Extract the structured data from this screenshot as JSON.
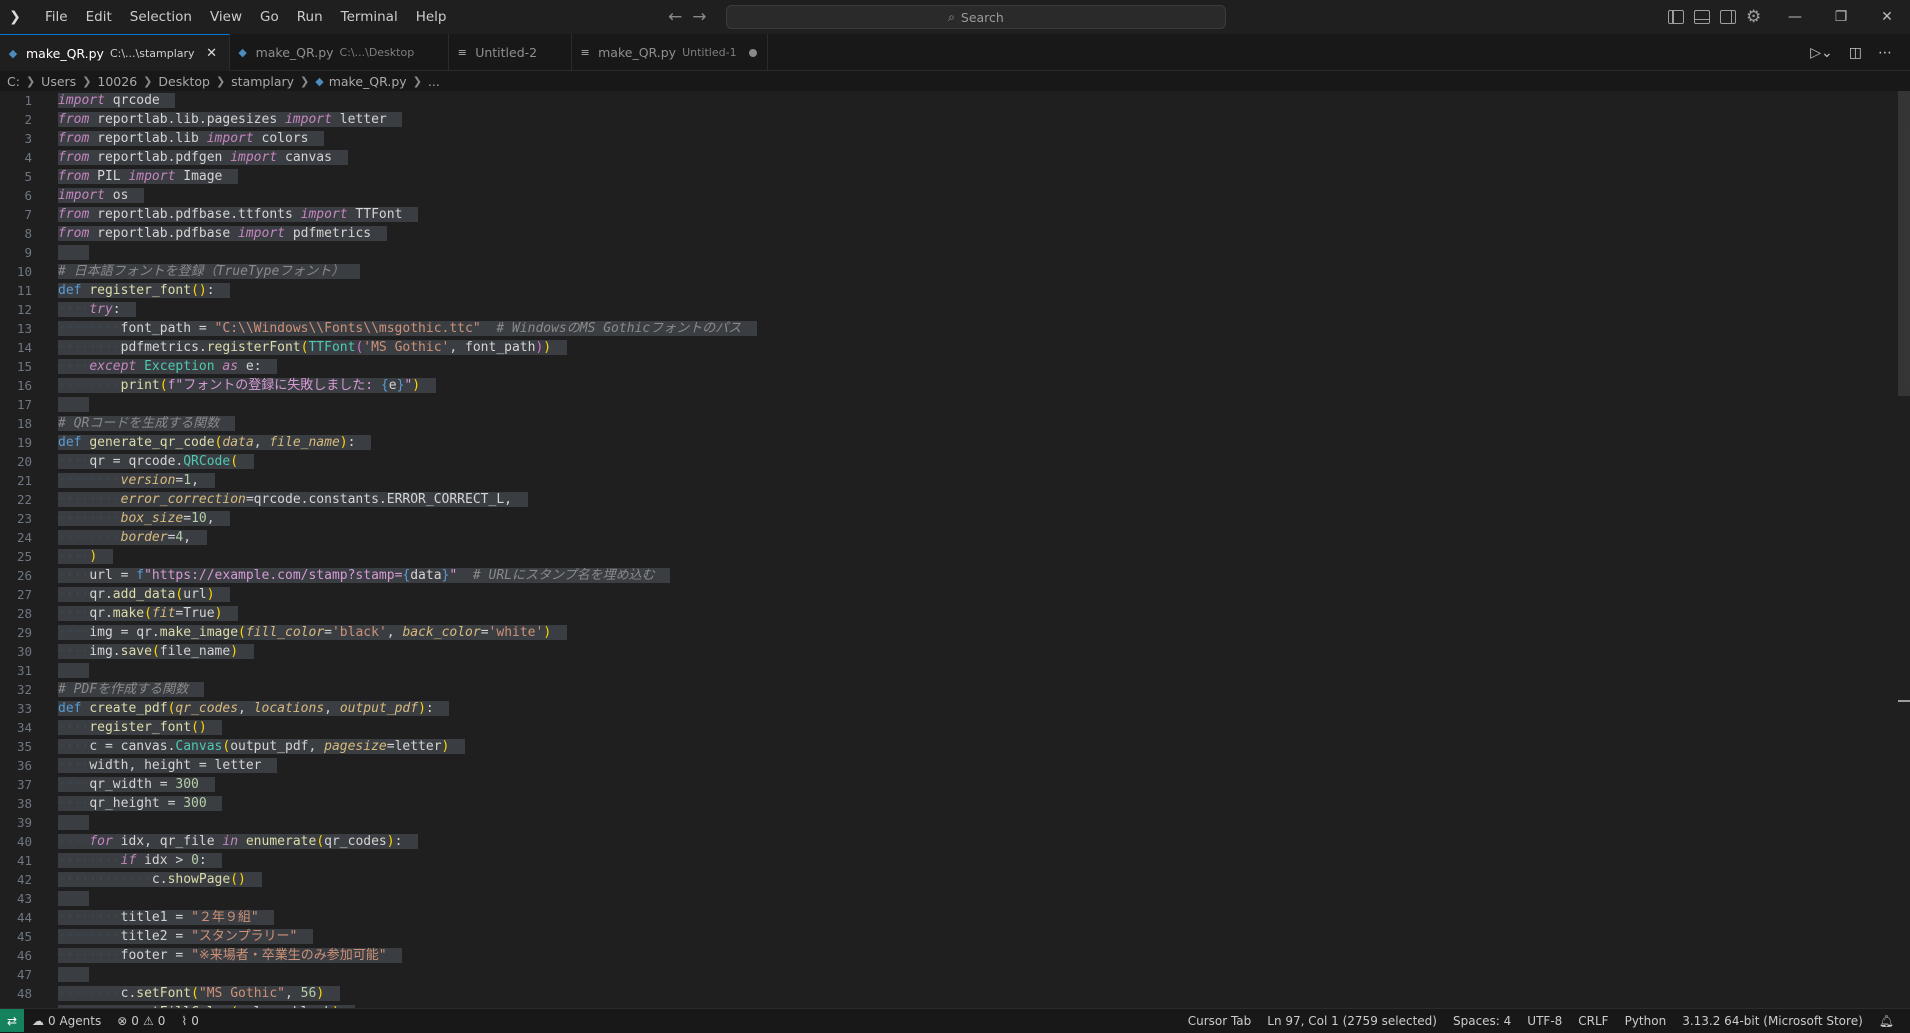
{
  "menu": [
    "File",
    "Edit",
    "Selection",
    "View",
    "Go",
    "Run",
    "Terminal",
    "Help"
  ],
  "search": {
    "label": "Search"
  },
  "tabs": [
    {
      "name": "make_QR.py",
      "desc": "C:\\...\\stamplary",
      "active": true,
      "icon": "python-icon",
      "close": "×"
    },
    {
      "name": "make_QR.py",
      "desc": "C:\\...\\Desktop",
      "active": false,
      "icon": "python-icon"
    },
    {
      "name": "Untitled-2",
      "desc": "",
      "active": false,
      "icon": "file-icon"
    },
    {
      "name": "make_QR.py",
      "desc": "Untitled-1",
      "active": false,
      "icon": "file-icon",
      "dirty": true
    }
  ],
  "breadcrumb": [
    "C:",
    "Users",
    "10026",
    "Desktop",
    "stamplary",
    "make_QR.py",
    "..."
  ],
  "status": {
    "agents": "0 Agents",
    "errors": "0",
    "warnings": "0",
    "ports": "0",
    "cursor_tab": "Cursor Tab",
    "position": "Ln 97, Col 1 (2759 selected)",
    "spaces": "Spaces: 4",
    "encoding": "UTF-8",
    "eol": "CRLF",
    "language": "Python",
    "interpreter": "3.13.2 64-bit (Microsoft Store)"
  },
  "code_lines": [
    [
      [
        "kw",
        "import"
      ],
      [
        "var",
        " qrcode"
      ]
    ],
    [
      [
        "kw",
        "from"
      ],
      [
        "var",
        " reportlab.lib.pagesizes "
      ],
      [
        "kw",
        "import"
      ],
      [
        "var",
        " letter"
      ]
    ],
    [
      [
        "kw",
        "from"
      ],
      [
        "var",
        " reportlab.lib "
      ],
      [
        "kw",
        "import"
      ],
      [
        "var",
        " colors"
      ]
    ],
    [
      [
        "kw",
        "from"
      ],
      [
        "var",
        " reportlab.pdfgen "
      ],
      [
        "kw",
        "import"
      ],
      [
        "var",
        " canvas"
      ]
    ],
    [
      [
        "kw",
        "from"
      ],
      [
        "var",
        " PIL "
      ],
      [
        "kw",
        "import"
      ],
      [
        "var",
        " Image"
      ]
    ],
    [
      [
        "kw",
        "import"
      ],
      [
        "var",
        " os"
      ]
    ],
    [
      [
        "kw",
        "from"
      ],
      [
        "var",
        " reportlab.pdfbase.ttfonts "
      ],
      [
        "kw",
        "import"
      ],
      [
        "var",
        " TTFont"
      ]
    ],
    [
      [
        "kw",
        "from"
      ],
      [
        "var",
        " reportlab.pdfbase "
      ],
      [
        "kw",
        "import"
      ],
      [
        "var",
        " pdfmetrics"
      ]
    ],
    [],
    [
      [
        "cm",
        "# 日本語フォントを登録（TrueTypeフォント）"
      ]
    ],
    [
      [
        "kw2",
        "def"
      ],
      [
        "var",
        " "
      ],
      [
        "fn",
        "register_font"
      ],
      [
        "br",
        "()"
      ],
      [
        "var",
        ":"
      ]
    ],
    [
      [
        "ws",
        "····"
      ],
      [
        "kw",
        "try"
      ],
      [
        "var",
        ":"
      ]
    ],
    [
      [
        "ws",
        "········"
      ],
      [
        "var",
        "font_path = "
      ],
      [
        "str",
        "\"C:\\\\Windows\\\\Fonts\\\\msgothic.ttc\""
      ],
      [
        "var",
        "  "
      ],
      [
        "cm",
        "# WindowsのMS Gothicフォントのパス"
      ]
    ],
    [
      [
        "ws",
        "········"
      ],
      [
        "var",
        "pdfmetrics."
      ],
      [
        "fn",
        "registerFont"
      ],
      [
        "br",
        "("
      ],
      [
        "cls",
        "TTFont"
      ],
      [
        "br2",
        "("
      ],
      [
        "str",
        "'MS Gothic'"
      ],
      [
        "var",
        ", font_path"
      ],
      [
        "br2",
        ")"
      ],
      [
        "br",
        ")"
      ]
    ],
    [
      [
        "ws",
        "····"
      ],
      [
        "kw",
        "except"
      ],
      [
        "var",
        " "
      ],
      [
        "cls",
        "Exception"
      ],
      [
        "var",
        " "
      ],
      [
        "kw",
        "as"
      ],
      [
        "var",
        " e:"
      ]
    ],
    [
      [
        "ws",
        "········"
      ],
      [
        "fn",
        "print"
      ],
      [
        "br",
        "("
      ],
      [
        "strp",
        "f\"フォントの登録に失敗しました: "
      ],
      [
        "kw2",
        "{"
      ],
      [
        "var",
        "e"
      ],
      [
        "kw2",
        "}"
      ],
      [
        "strp",
        "\""
      ],
      [
        "br",
        ")"
      ]
    ],
    [],
    [
      [
        "cm",
        "# QRコードを生成する関数"
      ]
    ],
    [
      [
        "kw2",
        "def"
      ],
      [
        "var",
        " "
      ],
      [
        "fn",
        "generate_qr_code"
      ],
      [
        "br",
        "("
      ],
      [
        "prm",
        "data"
      ],
      [
        "var",
        ", "
      ],
      [
        "prm",
        "file_name"
      ],
      [
        "br",
        ")"
      ],
      [
        "var",
        ":"
      ]
    ],
    [
      [
        "ws",
        "····"
      ],
      [
        "var",
        "qr = qrcode."
      ],
      [
        "cls",
        "QRCode"
      ],
      [
        "br",
        "("
      ]
    ],
    [
      [
        "ws",
        "········"
      ],
      [
        "prm",
        "version"
      ],
      [
        "var",
        "="
      ],
      [
        "num",
        "1"
      ],
      [
        "var",
        ","
      ]
    ],
    [
      [
        "ws",
        "········"
      ],
      [
        "prm",
        "error_correction"
      ],
      [
        "var",
        "=qrcode.constants.ERROR_CORRECT_L,"
      ]
    ],
    [
      [
        "ws",
        "········"
      ],
      [
        "prm",
        "box_size"
      ],
      [
        "var",
        "="
      ],
      [
        "num",
        "10"
      ],
      [
        "var",
        ","
      ]
    ],
    [
      [
        "ws",
        "········"
      ],
      [
        "prm",
        "border"
      ],
      [
        "var",
        "="
      ],
      [
        "num",
        "4"
      ],
      [
        "var",
        ","
      ]
    ],
    [
      [
        "ws",
        "····"
      ],
      [
        "br",
        ")"
      ]
    ],
    [
      [
        "ws",
        "····"
      ],
      [
        "var",
        "url = "
      ],
      [
        "kw2",
        "f"
      ],
      [
        "strp",
        "\"https://example.com/stamp?stamp="
      ],
      [
        "kw2",
        "{"
      ],
      [
        "var",
        "data"
      ],
      [
        "kw2",
        "}"
      ],
      [
        "strp",
        "\""
      ],
      [
        "var",
        "  "
      ],
      [
        "cm",
        "# URLにスタンプ名を埋め込む"
      ]
    ],
    [
      [
        "ws",
        "····"
      ],
      [
        "var",
        "qr."
      ],
      [
        "fn",
        "add_data"
      ],
      [
        "br",
        "("
      ],
      [
        "var",
        "url"
      ],
      [
        "br",
        ")"
      ]
    ],
    [
      [
        "ws",
        "····"
      ],
      [
        "var",
        "qr."
      ],
      [
        "fn",
        "make"
      ],
      [
        "br",
        "("
      ],
      [
        "prm",
        "fit"
      ],
      [
        "var",
        "=True"
      ],
      [
        "br",
        ")"
      ]
    ],
    [
      [
        "ws",
        "····"
      ],
      [
        "var",
        "img = qr."
      ],
      [
        "fn",
        "make_image"
      ],
      [
        "br",
        "("
      ],
      [
        "prm",
        "fill_color"
      ],
      [
        "var",
        "="
      ],
      [
        "str",
        "'black'"
      ],
      [
        "var",
        ", "
      ],
      [
        "prm",
        "back_color"
      ],
      [
        "var",
        "="
      ],
      [
        "str",
        "'white'"
      ],
      [
        "br",
        ")"
      ]
    ],
    [
      [
        "ws",
        "····"
      ],
      [
        "var",
        "img."
      ],
      [
        "fn",
        "save"
      ],
      [
        "br",
        "("
      ],
      [
        "var",
        "file_name"
      ],
      [
        "br",
        ")"
      ]
    ],
    [],
    [
      [
        "cm",
        "# PDFを作成する関数"
      ]
    ],
    [
      [
        "kw2",
        "def"
      ],
      [
        "var",
        " "
      ],
      [
        "fn",
        "create_pdf"
      ],
      [
        "br",
        "("
      ],
      [
        "prm",
        "qr_codes"
      ],
      [
        "var",
        ", "
      ],
      [
        "prm",
        "locations"
      ],
      [
        "var",
        ", "
      ],
      [
        "prm",
        "output_pdf"
      ],
      [
        "br",
        ")"
      ],
      [
        "var",
        ":"
      ]
    ],
    [
      [
        "ws",
        "····"
      ],
      [
        "fn",
        "register_font"
      ],
      [
        "br",
        "()"
      ]
    ],
    [
      [
        "ws",
        "····"
      ],
      [
        "var",
        "c = canvas."
      ],
      [
        "cls",
        "Canvas"
      ],
      [
        "br",
        "("
      ],
      [
        "var",
        "output_pdf, "
      ],
      [
        "prm",
        "pagesize"
      ],
      [
        "var",
        "=letter"
      ],
      [
        "br",
        ")"
      ]
    ],
    [
      [
        "ws",
        "····"
      ],
      [
        "var",
        "width, height = letter"
      ]
    ],
    [
      [
        "ws",
        "····"
      ],
      [
        "var",
        "qr_width = "
      ],
      [
        "num",
        "300"
      ]
    ],
    [
      [
        "ws",
        "····"
      ],
      [
        "var",
        "qr_height = "
      ],
      [
        "num",
        "300"
      ]
    ],
    [],
    [
      [
        "ws",
        "····"
      ],
      [
        "kw",
        "for"
      ],
      [
        "var",
        " idx, qr_file "
      ],
      [
        "kw",
        "in"
      ],
      [
        "var",
        " "
      ],
      [
        "fn",
        "enumerate"
      ],
      [
        "br",
        "("
      ],
      [
        "var",
        "qr_codes"
      ],
      [
        "br",
        ")"
      ],
      [
        "var",
        ":"
      ]
    ],
    [
      [
        "ws",
        "········"
      ],
      [
        "kw",
        "if"
      ],
      [
        "var",
        " idx > "
      ],
      [
        "num",
        "0"
      ],
      [
        "var",
        ":"
      ]
    ],
    [
      [
        "ws",
        "············"
      ],
      [
        "var",
        "c."
      ],
      [
        "fn",
        "showPage"
      ],
      [
        "br",
        "()"
      ]
    ],
    [],
    [
      [
        "ws",
        "········"
      ],
      [
        "var",
        "title1 = "
      ],
      [
        "str",
        "\"２年９組\""
      ]
    ],
    [
      [
        "ws",
        "········"
      ],
      [
        "var",
        "title2 = "
      ],
      [
        "str",
        "\"スタンプラリー\""
      ]
    ],
    [
      [
        "ws",
        "········"
      ],
      [
        "var",
        "footer = "
      ],
      [
        "str",
        "\"※来場者・卒業生のみ参加可能\""
      ]
    ],
    [],
    [
      [
        "ws",
        "········"
      ],
      [
        "var",
        "c."
      ],
      [
        "fn",
        "setFont"
      ],
      [
        "br",
        "("
      ],
      [
        "str",
        "\"MS Gothic\""
      ],
      [
        "var",
        ", "
      ],
      [
        "num",
        "56"
      ],
      [
        "br",
        ")"
      ]
    ],
    [
      [
        "ws",
        "········"
      ],
      [
        "var",
        "c."
      ],
      [
        "fn",
        "setFillColor"
      ],
      [
        "br",
        "("
      ],
      [
        "var",
        "colors.black"
      ],
      [
        "br",
        ")"
      ]
    ]
  ]
}
